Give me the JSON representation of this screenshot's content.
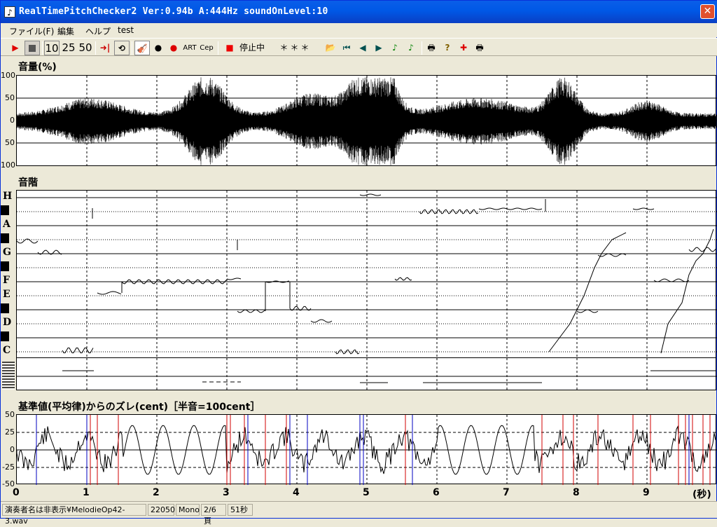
{
  "window": {
    "title": "RealTimePitchChecker2   Ver:0.94b      A:444Hz     soundOnLevel:10",
    "app_icon": "music-note-icon"
  },
  "menu": [
    "ファイル(F)",
    "編集",
    "ヘルプ",
    "test"
  ],
  "toolbar": {
    "speed_10": "10",
    "speed_25": "25",
    "speed_50": "50",
    "art": "ART",
    "cep": "Cep",
    "status": "停止中",
    "display": "＊＊＊"
  },
  "volume": {
    "title": "音量(%)",
    "yticks": [
      "100",
      "50",
      "0",
      "50",
      "100"
    ]
  },
  "scale": {
    "title": "音階",
    "notes": [
      "H",
      "A",
      "G",
      "F",
      "E",
      "D",
      "C"
    ]
  },
  "deviation": {
    "title": "基準値(平均律)からのズレ(cent)［半音=100cent］",
    "yticks": [
      "50",
      "25",
      "0",
      "-25",
      "-50"
    ]
  },
  "xaxis": {
    "ticks": [
      "0",
      "1",
      "2",
      "3",
      "4",
      "5",
      "6",
      "7",
      "8",
      "9"
    ],
    "unit": "(秒)"
  },
  "status": {
    "file": "演奏者名は非表示¥MelodieOp42-3.wav",
    "rate": "22050",
    "channel": "Mono",
    "page": "2/6頁",
    "duration": "51秒"
  }
}
